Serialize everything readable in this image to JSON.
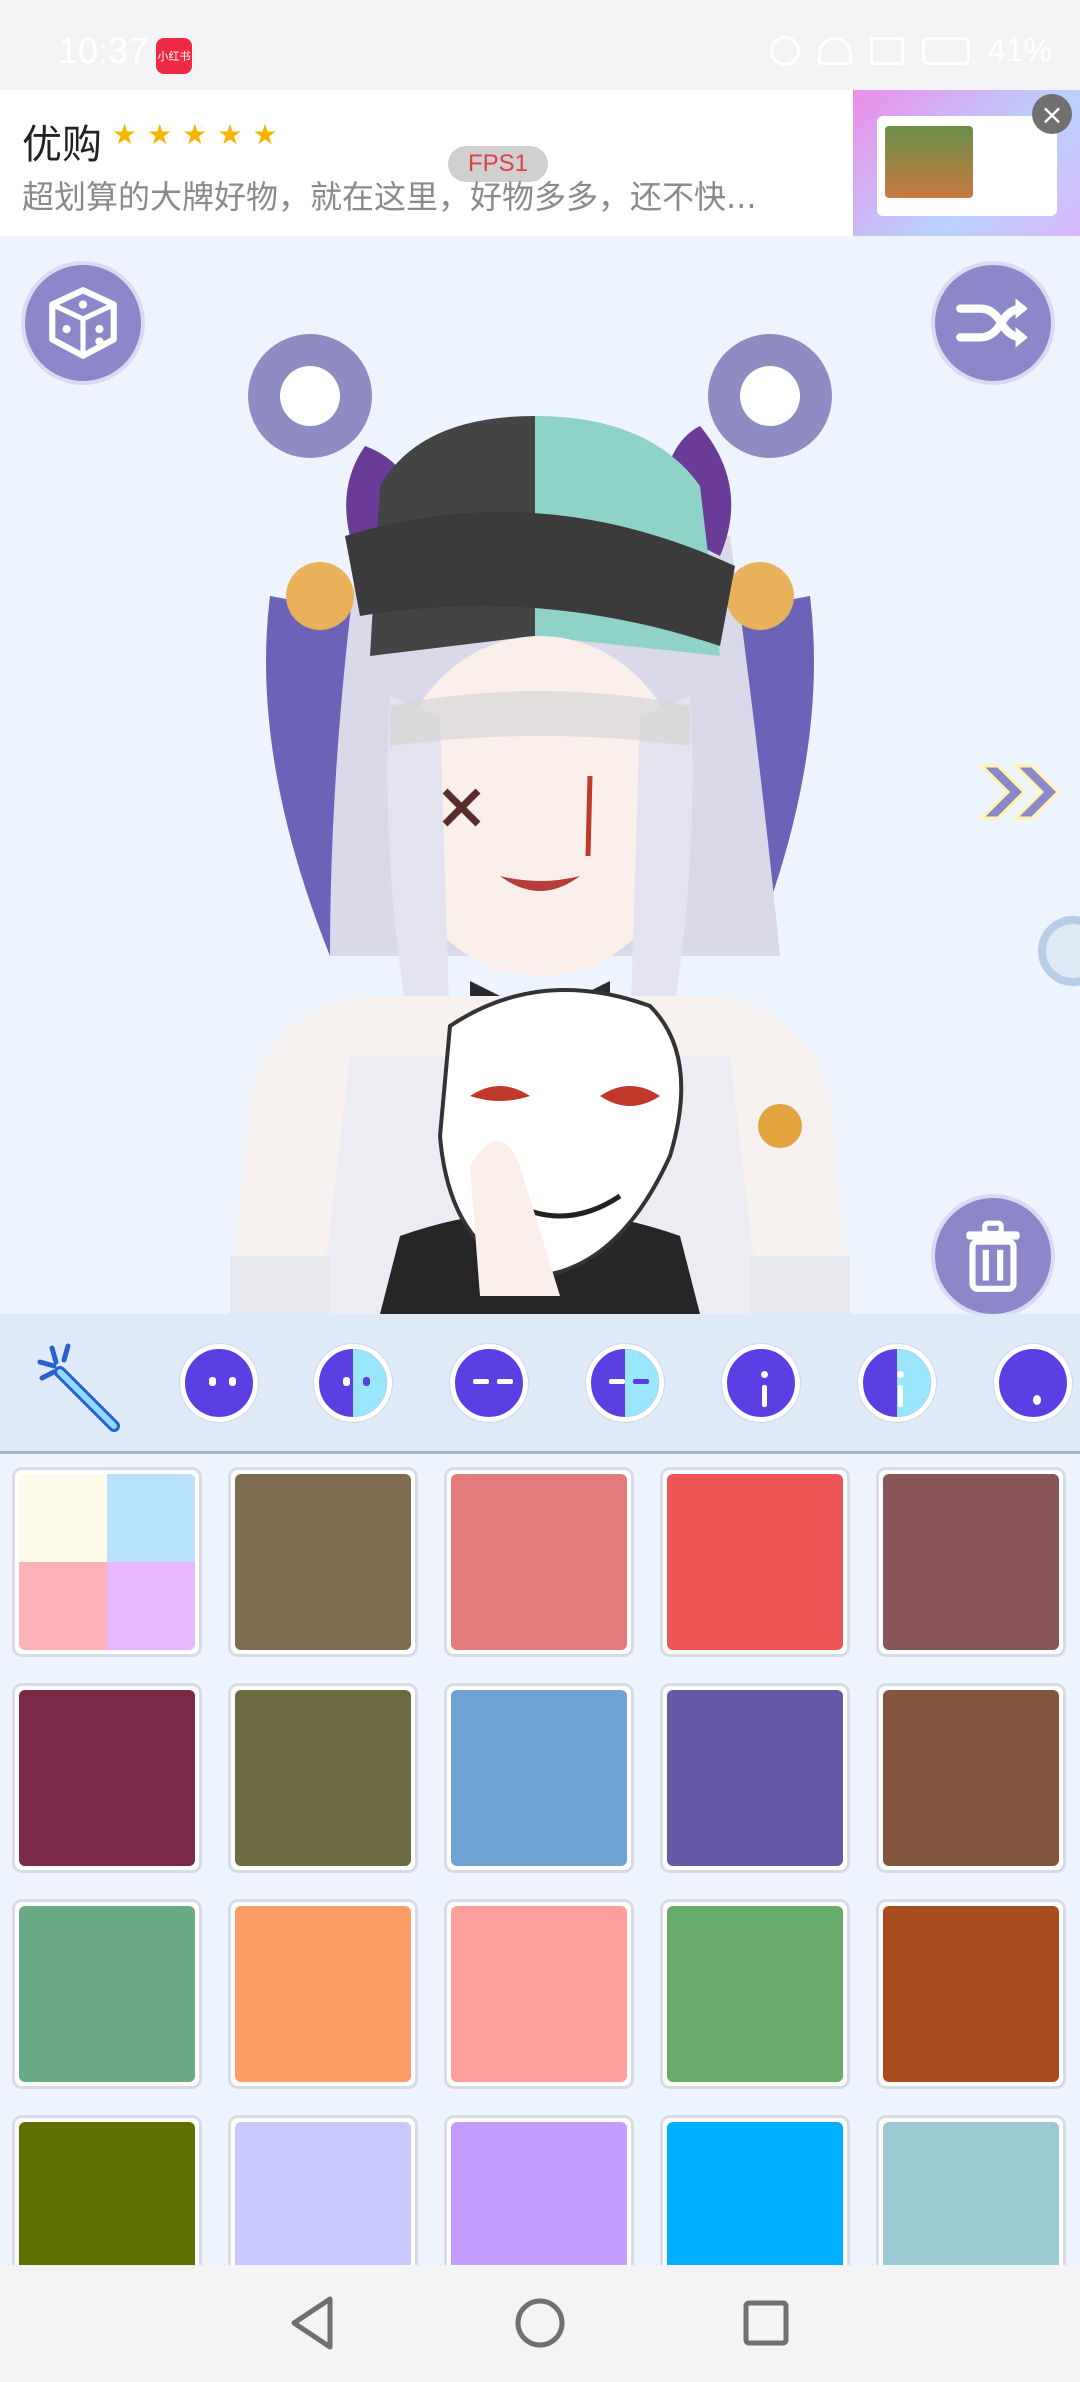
{
  "status_bar": {
    "time": "10:37",
    "app_badge": "小红书",
    "battery": "41%"
  },
  "ad": {
    "title": "优购",
    "rating_stars": 5,
    "description": "超划算的大牌好物，就在这里，好物多多，还不快...",
    "fps_badge": "FPS1",
    "close_icon": "close-icon"
  },
  "canvas": {
    "left_button_icon": "dice-icon",
    "right_button_icon": "shuffle-icon",
    "next_icon": "double-chevron-right-icon",
    "delete_icon": "trash-icon"
  },
  "toolbar": {
    "tools": [
      {
        "name": "magic-wand-icon"
      },
      {
        "name": "face-eyes-dots-icon",
        "split": false
      },
      {
        "name": "face-eyes-dots-half-icon",
        "split": true
      },
      {
        "name": "face-eyes-lines-icon",
        "split": false
      },
      {
        "name": "face-eyes-lines-half-icon",
        "split": true
      },
      {
        "name": "face-exclaim-icon",
        "split": false
      },
      {
        "name": "face-exclaim-half-icon",
        "split": true
      },
      {
        "name": "face-dot-icon",
        "split": false
      }
    ]
  },
  "palette": {
    "swatches": [
      {
        "type": "multi",
        "colors": [
          "#fffbea",
          "#b9e2ff",
          "#ffb3b8",
          "#e8b8ff"
        ]
      },
      {
        "color": "#7e6c51"
      },
      {
        "color": "#e37a7c"
      },
      {
        "color": "#ec5656"
      },
      {
        "color": "#885559"
      },
      {
        "color": "#7a2a48"
      },
      {
        "color": "#6c6c40"
      },
      {
        "color": "#6ea2d4"
      },
      {
        "color": "#6659a8"
      },
      {
        "color": "#83573e"
      },
      {
        "color": "#6aaa84"
      },
      {
        "color": "#ff9d67"
      },
      {
        "color": "#ff9f9d"
      },
      {
        "color": "#67ac6a"
      },
      {
        "color": "#a84c20"
      },
      {
        "color": "#607000"
      },
      {
        "color": "#c8caff"
      },
      {
        "color": "#c59dff"
      },
      {
        "color": "#00b0ff"
      },
      {
        "color": "#9ac9d3"
      }
    ]
  },
  "nav_bar": {
    "back_icon": "back-triangle-icon",
    "home_icon": "home-circle-icon",
    "recents_icon": "recents-square-icon"
  }
}
